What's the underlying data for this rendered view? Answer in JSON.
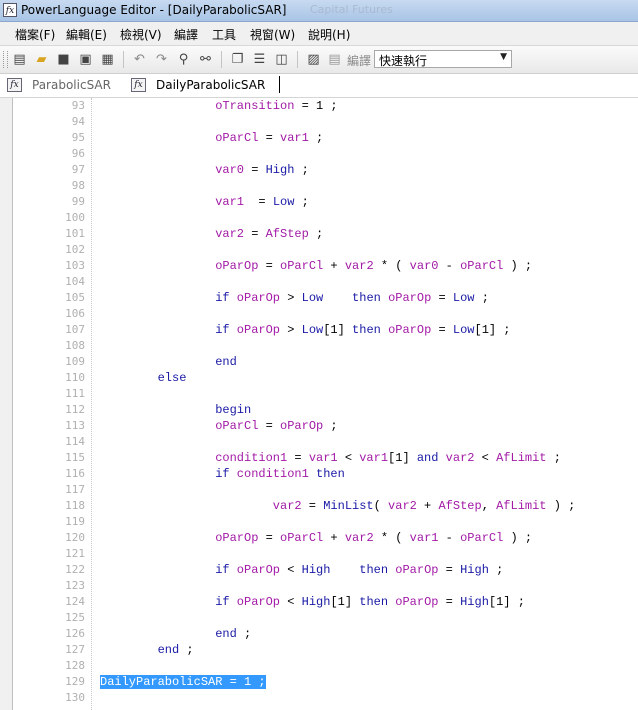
{
  "window": {
    "title": "PowerLanguage Editor - [DailyParabolicSAR]",
    "background_title": "Capital Futures"
  },
  "menu": [
    "檔案(F)",
    "編輯(E)",
    "檢視(V)",
    "編譯",
    "工具",
    "視窗(W)",
    "說明(H)"
  ],
  "toolbar": {
    "compile_label": "編譯",
    "combo_value": "快速執行"
  },
  "tabs": [
    {
      "label": "ParabolicSAR",
      "active": false
    },
    {
      "label": "DailyParabolicSAR",
      "active": true
    }
  ],
  "colors": {
    "keyword": "#1a1aa6",
    "variable": "#a21aa6",
    "selection": "#3399ff"
  },
  "code_lines": [
    {
      "n": "93",
      "i": 16,
      "t": [
        [
          "v",
          "oTransition"
        ],
        [
          "o",
          " = 1 ;"
        ]
      ]
    },
    {
      "n": "94",
      "i": 0,
      "t": []
    },
    {
      "n": "95",
      "i": 16,
      "t": [
        [
          "v",
          "oParCl"
        ],
        [
          "o",
          " = "
        ],
        [
          "v",
          "var1"
        ],
        [
          "o",
          " ;"
        ]
      ]
    },
    {
      "n": "96",
      "i": 0,
      "t": []
    },
    {
      "n": "97",
      "i": 16,
      "t": [
        [
          "v",
          "var0"
        ],
        [
          "o",
          " = "
        ],
        [
          "k",
          "High"
        ],
        [
          "o",
          " ;"
        ]
      ]
    },
    {
      "n": "98",
      "i": 0,
      "t": []
    },
    {
      "n": "99",
      "i": 16,
      "t": [
        [
          "v",
          "var1"
        ],
        [
          "o",
          "  = "
        ],
        [
          "k",
          "Low"
        ],
        [
          "o",
          " ;"
        ]
      ]
    },
    {
      "n": "100",
      "i": 0,
      "t": []
    },
    {
      "n": "101",
      "i": 16,
      "t": [
        [
          "v",
          "var2"
        ],
        [
          "o",
          " = "
        ],
        [
          "v",
          "AfStep"
        ],
        [
          "o",
          " ;"
        ]
      ]
    },
    {
      "n": "102",
      "i": 0,
      "t": []
    },
    {
      "n": "103",
      "i": 16,
      "t": [
        [
          "v",
          "oParOp"
        ],
        [
          "o",
          " = "
        ],
        [
          "v",
          "oParCl"
        ],
        [
          "o",
          " + "
        ],
        [
          "v",
          "var2"
        ],
        [
          "o",
          " * ( "
        ],
        [
          "v",
          "var0"
        ],
        [
          "o",
          " - "
        ],
        [
          "v",
          "oParCl"
        ],
        [
          "o",
          " ) ;"
        ]
      ]
    },
    {
      "n": "104",
      "i": 0,
      "t": []
    },
    {
      "n": "105",
      "i": 16,
      "t": [
        [
          "k",
          "if"
        ],
        [
          "o",
          " "
        ],
        [
          "v",
          "oParOp"
        ],
        [
          "o",
          " > "
        ],
        [
          "k",
          "Low"
        ],
        [
          "o",
          "    "
        ],
        [
          "k",
          "then"
        ],
        [
          "o",
          " "
        ],
        [
          "v",
          "oParOp"
        ],
        [
          "o",
          " = "
        ],
        [
          "k",
          "Low"
        ],
        [
          "o",
          " ;"
        ]
      ]
    },
    {
      "n": "106",
      "i": 0,
      "t": []
    },
    {
      "n": "107",
      "i": 16,
      "t": [
        [
          "k",
          "if"
        ],
        [
          "o",
          " "
        ],
        [
          "v",
          "oParOp"
        ],
        [
          "o",
          " > "
        ],
        [
          "k",
          "Low"
        ],
        [
          "o",
          "[1] "
        ],
        [
          "k",
          "then"
        ],
        [
          "o",
          " "
        ],
        [
          "v",
          "oParOp"
        ],
        [
          "o",
          " = "
        ],
        [
          "k",
          "Low"
        ],
        [
          "o",
          "[1] ;"
        ]
      ]
    },
    {
      "n": "108",
      "i": 0,
      "t": []
    },
    {
      "n": "109",
      "i": 16,
      "t": [
        [
          "k",
          "end"
        ]
      ]
    },
    {
      "n": "110",
      "i": 8,
      "t": [
        [
          "k",
          "else"
        ]
      ]
    },
    {
      "n": "111",
      "i": 0,
      "t": []
    },
    {
      "n": "112",
      "i": 16,
      "t": [
        [
          "k",
          "begin"
        ]
      ]
    },
    {
      "n": "113",
      "i": 16,
      "t": [
        [
          "v",
          "oParCl"
        ],
        [
          "o",
          " = "
        ],
        [
          "v",
          "oParOp"
        ],
        [
          "o",
          " ;"
        ]
      ]
    },
    {
      "n": "114",
      "i": 0,
      "t": []
    },
    {
      "n": "115",
      "i": 16,
      "t": [
        [
          "v",
          "condition1"
        ],
        [
          "o",
          " = "
        ],
        [
          "v",
          "var1"
        ],
        [
          "o",
          " < "
        ],
        [
          "v",
          "var1"
        ],
        [
          "o",
          "[1] "
        ],
        [
          "k",
          "and"
        ],
        [
          "o",
          " "
        ],
        [
          "v",
          "var2"
        ],
        [
          "o",
          " < "
        ],
        [
          "v",
          "AfLimit"
        ],
        [
          "o",
          " ;"
        ]
      ]
    },
    {
      "n": "116",
      "i": 16,
      "t": [
        [
          "k",
          "if"
        ],
        [
          "o",
          " "
        ],
        [
          "v",
          "condition1"
        ],
        [
          "o",
          " "
        ],
        [
          "k",
          "then"
        ]
      ]
    },
    {
      "n": "117",
      "i": 0,
      "t": []
    },
    {
      "n": "118",
      "i": 24,
      "t": [
        [
          "v",
          "var2"
        ],
        [
          "o",
          " = "
        ],
        [
          "k",
          "MinList"
        ],
        [
          "o",
          "( "
        ],
        [
          "v",
          "var2"
        ],
        [
          "o",
          " + "
        ],
        [
          "v",
          "AfStep"
        ],
        [
          "o",
          ", "
        ],
        [
          "v",
          "AfLimit"
        ],
        [
          "o",
          " ) ;"
        ]
      ]
    },
    {
      "n": "119",
      "i": 0,
      "t": []
    },
    {
      "n": "120",
      "i": 16,
      "t": [
        [
          "v",
          "oParOp"
        ],
        [
          "o",
          " = "
        ],
        [
          "v",
          "oParCl"
        ],
        [
          "o",
          " + "
        ],
        [
          "v",
          "var2"
        ],
        [
          "o",
          " * ( "
        ],
        [
          "v",
          "var1"
        ],
        [
          "o",
          " - "
        ],
        [
          "v",
          "oParCl"
        ],
        [
          "o",
          " ) ;"
        ]
      ]
    },
    {
      "n": "121",
      "i": 0,
      "t": []
    },
    {
      "n": "122",
      "i": 16,
      "t": [
        [
          "k",
          "if"
        ],
        [
          "o",
          " "
        ],
        [
          "v",
          "oParOp"
        ],
        [
          "o",
          " < "
        ],
        [
          "k",
          "High"
        ],
        [
          "o",
          "    "
        ],
        [
          "k",
          "then"
        ],
        [
          "o",
          " "
        ],
        [
          "v",
          "oParOp"
        ],
        [
          "o",
          " = "
        ],
        [
          "k",
          "High"
        ],
        [
          "o",
          " ;"
        ]
      ]
    },
    {
      "n": "123",
      "i": 0,
      "t": []
    },
    {
      "n": "124",
      "i": 16,
      "t": [
        [
          "k",
          "if"
        ],
        [
          "o",
          " "
        ],
        [
          "v",
          "oParOp"
        ],
        [
          "o",
          " < "
        ],
        [
          "k",
          "High"
        ],
        [
          "o",
          "[1] "
        ],
        [
          "k",
          "then"
        ],
        [
          "o",
          " "
        ],
        [
          "v",
          "oParOp"
        ],
        [
          "o",
          " = "
        ],
        [
          "k",
          "High"
        ],
        [
          "o",
          "[1] ;"
        ]
      ]
    },
    {
      "n": "125",
      "i": 0,
      "t": []
    },
    {
      "n": "126",
      "i": 16,
      "t": [
        [
          "k",
          "end"
        ],
        [
          "o",
          " ;"
        ]
      ]
    },
    {
      "n": "127",
      "i": 8,
      "t": [
        [
          "k",
          "end"
        ],
        [
          "o",
          " ;"
        ]
      ]
    },
    {
      "n": "128",
      "i": 0,
      "t": []
    },
    {
      "n": "129",
      "i": 0,
      "hl": true,
      "t": [
        [
          "s",
          "DailyParabolicSAR = 1 ;"
        ]
      ]
    },
    {
      "n": "130",
      "i": 0,
      "t": []
    }
  ]
}
